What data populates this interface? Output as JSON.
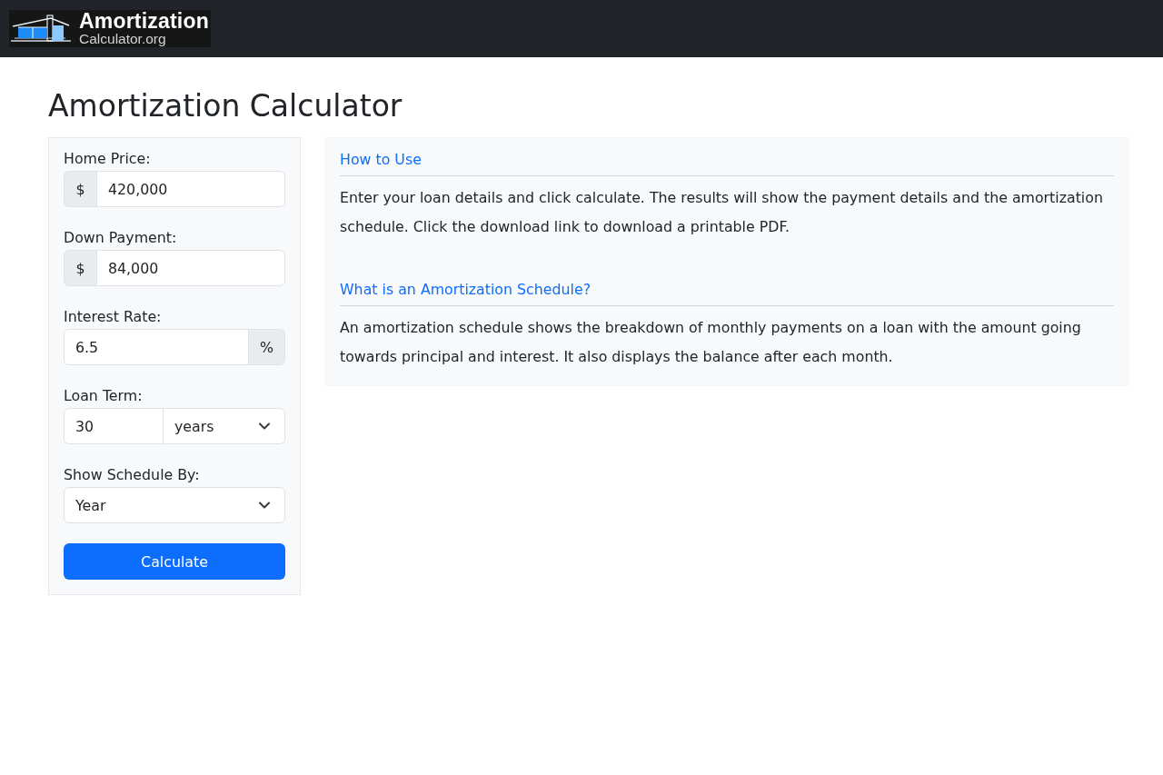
{
  "header": {
    "logo": {
      "title": "Amortization",
      "subtitle": "Calculator.org"
    }
  },
  "page_title": "Amortization Calculator",
  "form": {
    "fields": [
      {
        "kind": "prefix",
        "label": "Home Price:",
        "addon": "$",
        "value": "420,000"
      },
      {
        "kind": "prefix",
        "label": "Down Payment:",
        "addon": "$",
        "value": "84,000"
      },
      {
        "kind": "suffix",
        "label": "Interest Rate:",
        "addon": "%",
        "value": "6.5"
      },
      {
        "kind": "number_select",
        "label": "Loan Term:",
        "value": "30",
        "select": "years"
      },
      {
        "kind": "select",
        "label": "Show Schedule By:",
        "select": "Year"
      }
    ],
    "submit": "Calculate"
  },
  "info": {
    "sections": [
      {
        "heading": "How to Use",
        "text": "Enter your loan details and click calculate. The results will show the payment details and the amortization schedule. Click the download link to download a printable PDF."
      },
      {
        "heading": "What is an Amortization Schedule?",
        "text": "An amortization schedule shows the breakdown of monthly payments on a loan with the amount going towards principal and interest. It also displays the balance after each month."
      }
    ]
  }
}
